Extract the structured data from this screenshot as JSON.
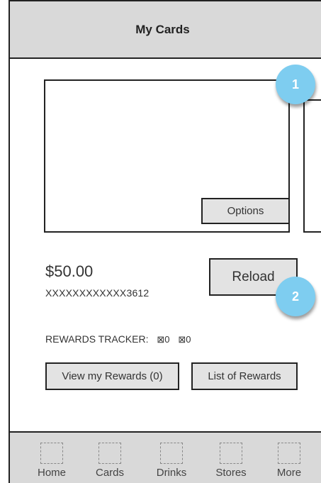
{
  "header": {
    "title": "My Cards"
  },
  "card": {
    "options_label": "Options"
  },
  "badges": [
    "1",
    "2"
  ],
  "account": {
    "balance": "$50.00",
    "card_number": "XXXXXXXXXXXX3612",
    "reload_label": "Reload"
  },
  "rewards": {
    "tracker_label": "REWARDS TRACKER:",
    "tracker_values": [
      "⊠0",
      "⊠0"
    ],
    "view_label": "View my Rewards (0)",
    "list_label": "List of Rewards"
  },
  "tabbar": {
    "items": [
      {
        "label": "Home",
        "icon": "home-icon-placeholder"
      },
      {
        "label": "Cards",
        "icon": "cards-icon-placeholder"
      },
      {
        "label": "Drinks",
        "icon": "drinks-icon-placeholder"
      },
      {
        "label": "Stores",
        "icon": "stores-icon-placeholder"
      },
      {
        "label": "More",
        "icon": "more-icon-placeholder"
      }
    ]
  },
  "colors": {
    "header_bg": "#d9d9d9",
    "button_bg": "#e3e3e3",
    "badge": "#7ecdf0"
  }
}
